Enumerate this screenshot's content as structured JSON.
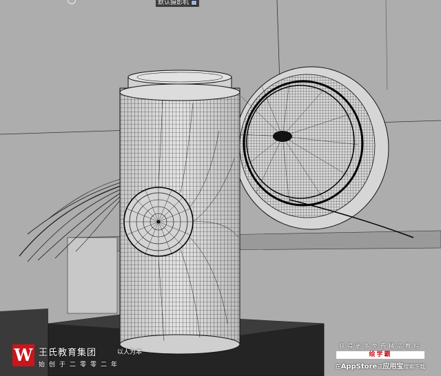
{
  "viewport": {
    "camera_label": "默认摄影机",
    "icons": [
      "camera-icon",
      "axis-gizmo-icon"
    ]
  },
  "scene": {
    "objects": [
      "cylinder-can-wireframe",
      "round-lid-wireframe",
      "feather-plume",
      "display-pedestal",
      "back-shelf"
    ],
    "colors": {
      "background": "#adadad",
      "wire": "#1a1a1a",
      "surface": "#d9d9d9",
      "pedestal": "#2a2a2a"
    }
  },
  "watermark": {
    "logo_letter": "W",
    "company_name": "王氏教育集团",
    "slogan": "以人为本",
    "founded": "始创于二零零二年",
    "logo_color": "#c8161d"
  },
  "promo": {
    "line1": "获得更多免费精品教程",
    "app_name": "绘学霸",
    "line3_pre": "在",
    "store1": "AppStore",
    "line3_mid": "或",
    "store2": "应用宝",
    "line3_post": "搜索下载"
  }
}
